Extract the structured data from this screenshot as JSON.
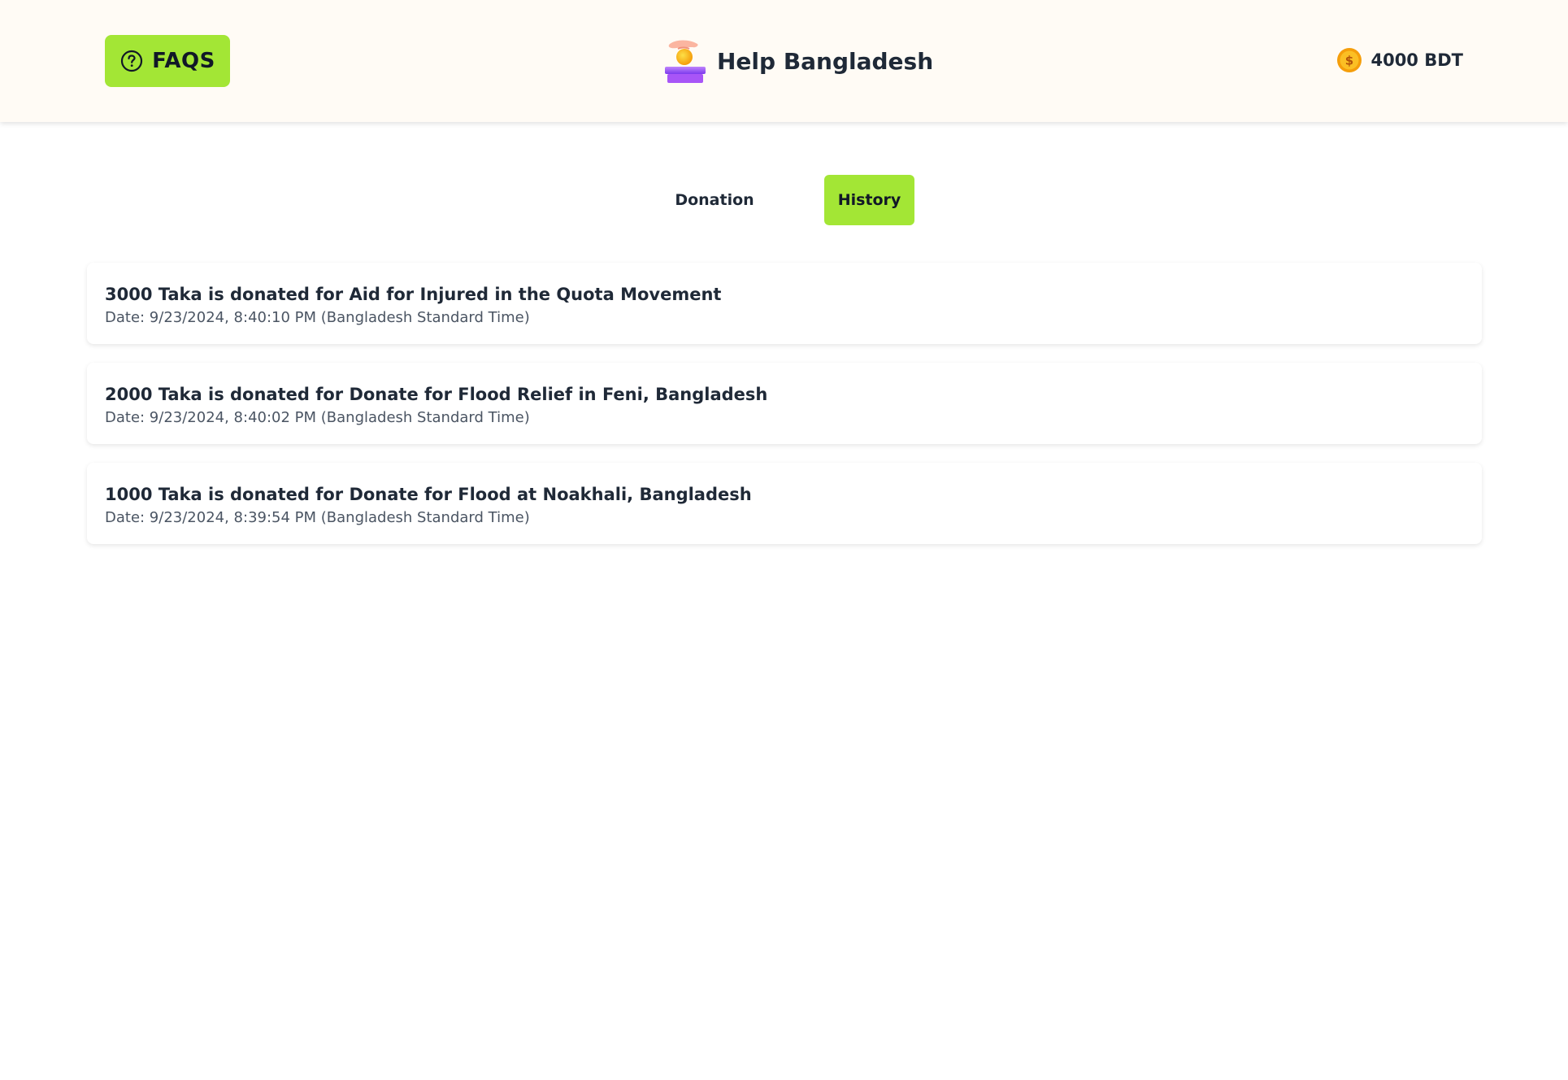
{
  "header": {
    "faq_label": "FAQS",
    "brand_title": "Help Bangladesh",
    "balance": "4000 BDT"
  },
  "tabs": [
    {
      "label": "Donation",
      "active": false
    },
    {
      "label": "History",
      "active": true
    }
  ],
  "history": [
    {
      "description": "3000 Taka is donated for Aid for Injured in the Quota Movement",
      "date": "Date: 9/23/2024, 8:40:10 PM (Bangladesh Standard Time)"
    },
    {
      "description": "2000 Taka is donated for Donate for Flood Relief in Feni, Bangladesh",
      "date": "Date: 9/23/2024, 8:40:02 PM (Bangladesh Standard Time)"
    },
    {
      "description": "1000 Taka is donated for Donate for Flood at Noakhali, Bangladesh",
      "date": "Date: 9/23/2024, 8:39:54 PM (Bangladesh Standard Time)"
    }
  ],
  "icons": {
    "faq": "question-circle-icon",
    "brand": "donation-hand-coin-icon",
    "balance": "gold-coin-icon"
  },
  "colors": {
    "accent": "#a3e635",
    "header_bg": "#fffbf5",
    "text": "#1f2937",
    "muted": "#4b5563"
  }
}
